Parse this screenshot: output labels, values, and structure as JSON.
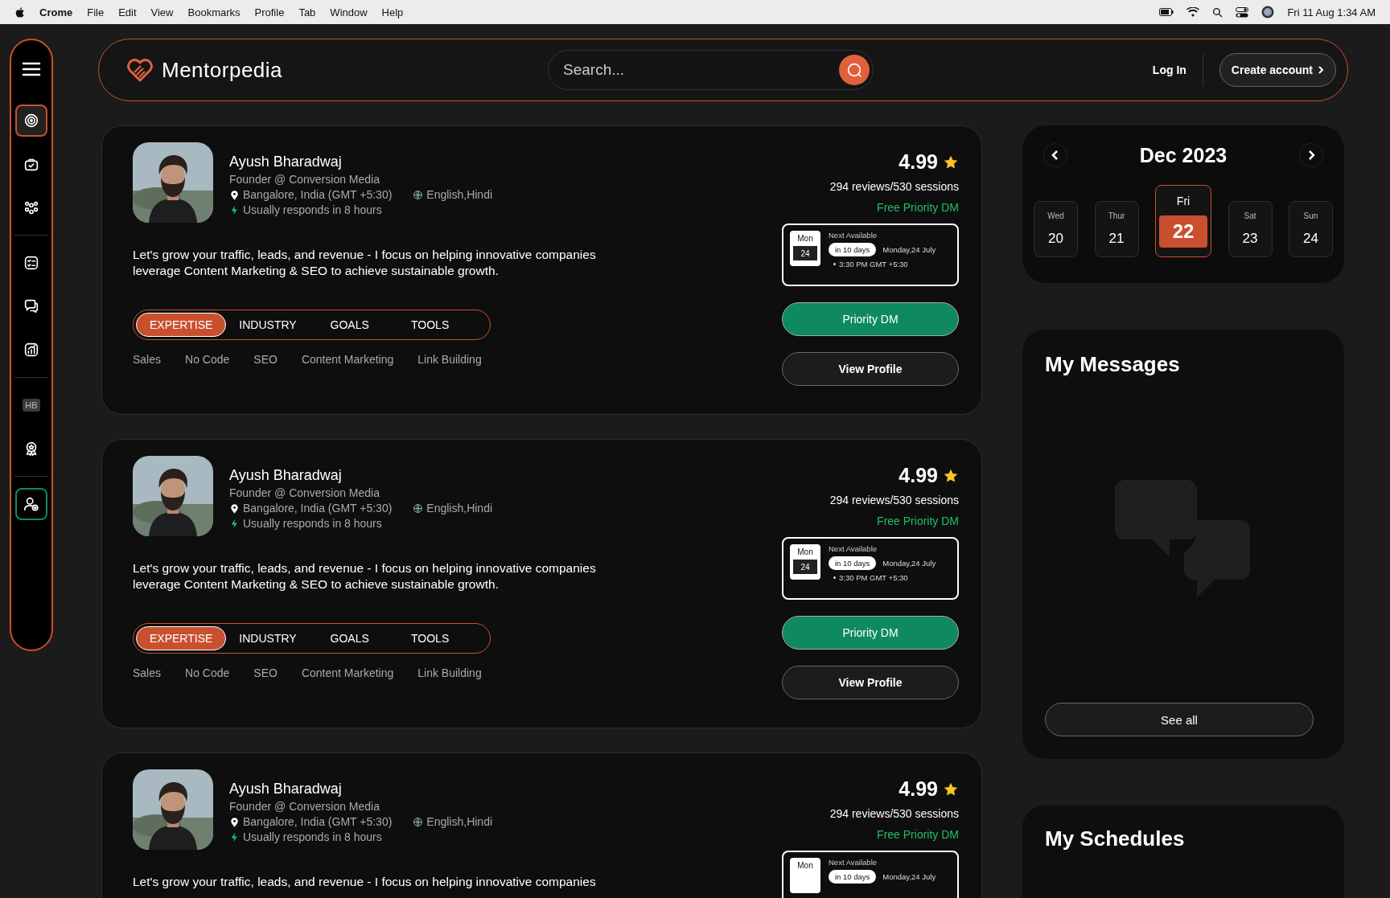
{
  "menu_bar": {
    "app_name": "Crome",
    "menus": [
      "File",
      "Edit",
      "View",
      "Bookmarks",
      "Profile",
      "Tab",
      "Window",
      "Help"
    ],
    "clock": "Fri 11 Aug 1:34 AM"
  },
  "sidebar": {
    "groups": [
      [
        {
          "kind": "nav",
          "selected": true
        },
        {
          "kind": "nav",
          "selected": false
        },
        {
          "kind": "nav",
          "selected": false
        }
      ],
      [
        {
          "kind": "nav",
          "selected": false
        },
        {
          "kind": "nav",
          "selected": false
        },
        {
          "kind": "nav",
          "selected": false
        }
      ],
      [
        {
          "kind": "badge",
          "label": "HB",
          "selected": false
        },
        {
          "kind": "nav",
          "selected": false
        }
      ],
      [
        {
          "kind": "action",
          "selected": false
        }
      ]
    ]
  },
  "header": {
    "brand": "Mentorpedia",
    "search": {
      "placeholder": "Search..."
    },
    "login": "Log In",
    "signup": "Create account"
  },
  "mentors": [
    {
      "name": "Ayush Bharadwaj",
      "role": "Founder @ Conversion Media",
      "location": "Bangalore, India (GMT +5:30)",
      "languages": "English,Hindi",
      "response": "Usually responds in 8 hours",
      "description": "Let's grow your traffic, leads, and revenue - I focus on helping innovative companies leverage Content Marketing & SEO to achieve sustainable growth.",
      "rating": "4.99",
      "stats": "294 reviews/530 sessions",
      "offer": "Free Priority DM",
      "availability": {
        "day": "Mon",
        "date": "24",
        "label": "Next Available",
        "badge": "in 10 days",
        "date_text": "Monday,24 July",
        "time": "3:30 PM GMT +5:30"
      },
      "tabs": [
        {
          "label": "EXPERTISE",
          "selected": true
        },
        {
          "label": "INDUSTRY",
          "selected": false
        },
        {
          "label": "GOALS",
          "selected": false
        },
        {
          "label": "TOOLS",
          "selected": false
        }
      ],
      "tags": [
        "Sales",
        "No Code",
        "SEO",
        "Content Marketing",
        "Link Building"
      ],
      "primary_button": "Priority DM",
      "secondary_button": "View Profile"
    },
    {
      "name": "Ayush Bharadwaj",
      "role": "Founder @ Conversion Media",
      "location": "Bangalore, India (GMT +5:30)",
      "languages": "English,Hindi",
      "response": "Usually responds in 8 hours",
      "description": "Let's grow your traffic, leads, and revenue - I focus on helping innovative companies leverage Content Marketing & SEO to achieve sustainable growth.",
      "rating": "4.99",
      "stats": "294 reviews/530 sessions",
      "offer": "Free Priority DM",
      "availability": {
        "day": "Mon",
        "date": "24",
        "label": "Next Available",
        "badge": "in 10 days",
        "date_text": "Monday,24 July",
        "time": "3:30 PM GMT +5:30"
      },
      "tabs": [
        {
          "label": "EXPERTISE",
          "selected": true
        },
        {
          "label": "INDUSTRY",
          "selected": false
        },
        {
          "label": "GOALS",
          "selected": false
        },
        {
          "label": "TOOLS",
          "selected": false
        }
      ],
      "tags": [
        "Sales",
        "No Code",
        "SEO",
        "Content Marketing",
        "Link Building"
      ],
      "primary_button": "Priority DM",
      "secondary_button": "View Profile"
    },
    {
      "name": "Ayush Bharadwaj",
      "role": "Founder @ Conversion Media",
      "location": "Bangalore, India (GMT +5:30)",
      "languages": "English,Hindi",
      "response": "Usually responds in 8 hours",
      "description": "Let's grow your traffic, leads, and revenue - I focus on helping innovative companies",
      "rating": "4.99",
      "stats": "294 reviews/530 sessions",
      "offer": "Free Priority DM",
      "availability": {
        "day": "Mon",
        "label": "Next Available",
        "badge": "in 10 days",
        "date_text": "Monday,24 July"
      }
    }
  ],
  "calendar": {
    "title": "Dec 2023",
    "days": [
      {
        "weekday": "Wed",
        "date": "20",
        "selected": false
      },
      {
        "weekday": "Thur",
        "date": "21",
        "selected": false
      },
      {
        "weekday": "Fri",
        "date": "22",
        "selected": true
      },
      {
        "weekday": "Sat",
        "date": "23",
        "selected": false
      },
      {
        "weekday": "Sun",
        "date": "24",
        "selected": false
      }
    ]
  },
  "messages": {
    "title": "My Messages",
    "button": "See all"
  },
  "schedules": {
    "title": "My Schedules"
  }
}
